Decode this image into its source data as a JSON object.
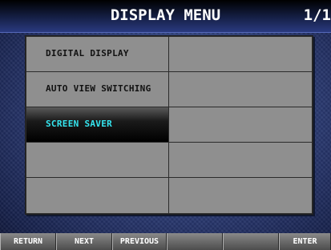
{
  "header": {
    "title": "DISPLAY MENU",
    "page": "1/1"
  },
  "menu": {
    "rows": [
      {
        "left": "DIGITAL DISPLAY",
        "right": ""
      },
      {
        "left": "AUTO VIEW SWITCHING",
        "right": ""
      },
      {
        "left": "SCREEN SAVER",
        "right": ""
      },
      {
        "left": "",
        "right": ""
      },
      {
        "left": "",
        "right": ""
      }
    ],
    "selected_index": 2,
    "selected_text_color": "#35e6f0"
  },
  "function_keys": [
    {
      "label": "RETURN"
    },
    {
      "label": "NEXT"
    },
    {
      "label": "PREVIOUS"
    },
    {
      "label": ""
    },
    {
      "label": ""
    },
    {
      "label": "ENTER"
    }
  ],
  "colors": {
    "background": "#2d3e78",
    "cell": "#8f8f8f",
    "selected_cell": "#000000"
  }
}
